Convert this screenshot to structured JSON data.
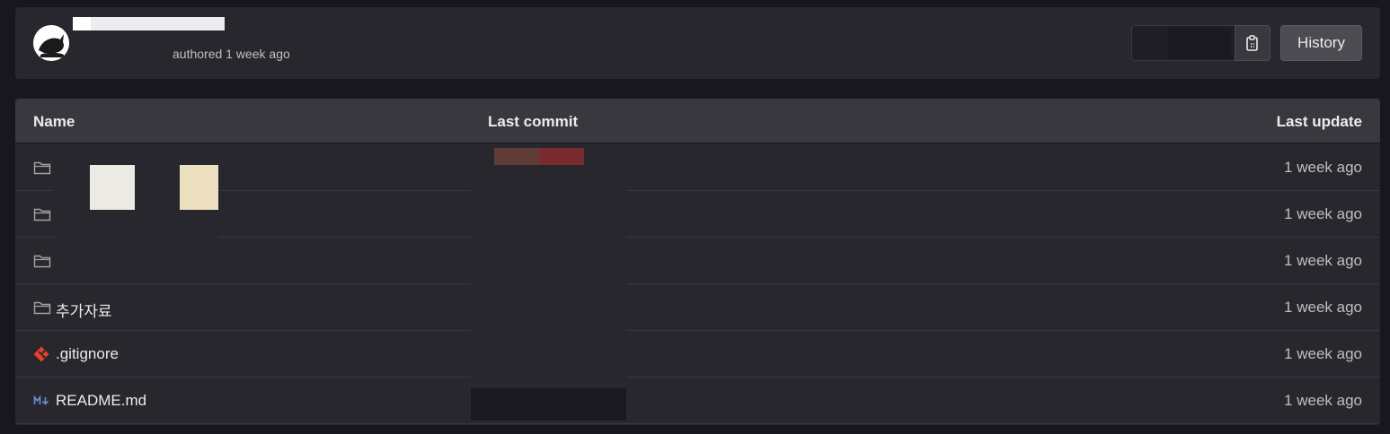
{
  "commit": {
    "author_line": "authored 1 week ago",
    "history_label": "History"
  },
  "table": {
    "headers": {
      "name": "Name",
      "last_commit": "Last commit",
      "last_update": "Last update"
    },
    "rows": [
      {
        "type": "folder",
        "name": "",
        "updated": "1 week ago"
      },
      {
        "type": "folder",
        "name": "",
        "updated": "1 week ago"
      },
      {
        "type": "folder",
        "name": "",
        "updated": "1 week ago"
      },
      {
        "type": "folder",
        "name": "추가자료",
        "updated": "1 week ago"
      },
      {
        "type": "git",
        "name": ".gitignore",
        "updated": "1 week ago"
      },
      {
        "type": "markdown",
        "name": "README.md",
        "updated": "1 week ago"
      }
    ]
  },
  "icons": {
    "folder": "folder-icon",
    "git": "git-icon",
    "markdown": "markdown-icon",
    "copy": "clipboard-copy-icon"
  },
  "colors": {
    "git_icon": "#e24329",
    "markdown_icon": "#6b8fd6"
  }
}
